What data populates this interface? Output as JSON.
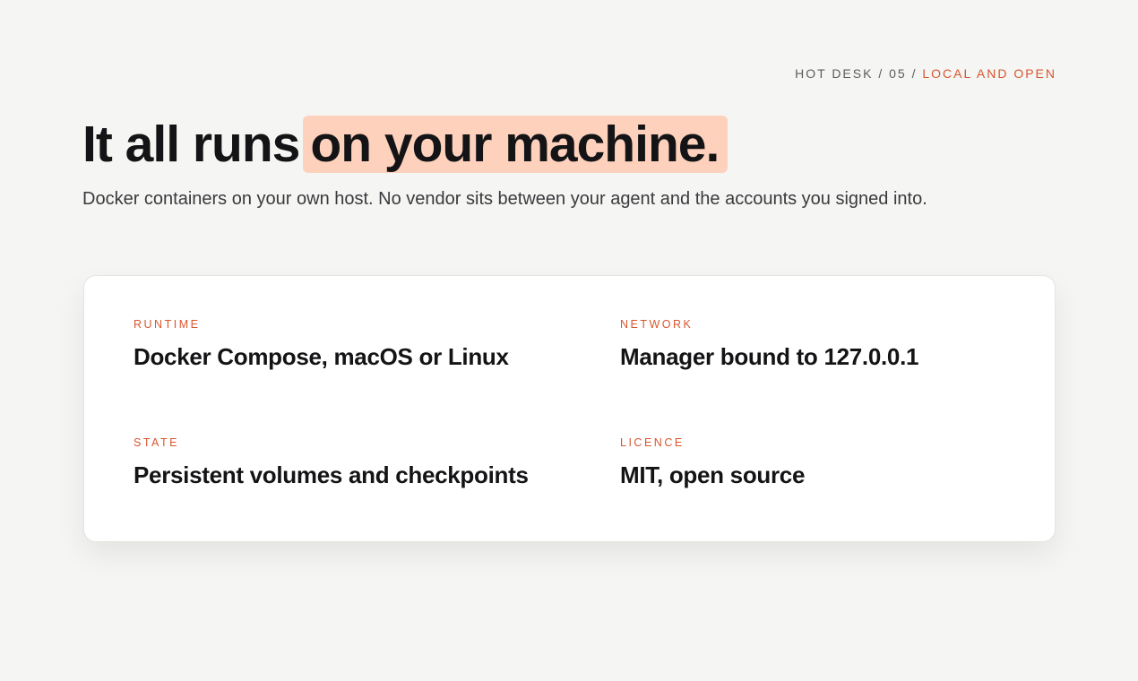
{
  "breadcrumb": {
    "prefix": "HOT DESK / 05 /",
    "current": "LOCAL AND OPEN"
  },
  "headline": {
    "plain": "It all runs",
    "highlight": "on your machine."
  },
  "subtitle": "Docker containers on your own host. No vendor sits between your agent and the accounts you signed into.",
  "specs": [
    {
      "label": "RUNTIME",
      "value": "Docker Compose, macOS or Linux"
    },
    {
      "label": "NETWORK",
      "value": "Manager bound to 127.0.0.1"
    },
    {
      "label": "STATE",
      "value": "Persistent volumes and checkpoints"
    },
    {
      "label": "LICENCE",
      "value": "MIT, open source"
    }
  ],
  "colors": {
    "accent": "#d9562f",
    "highlight": "#fdd1bc",
    "background": "#f5f5f3"
  }
}
